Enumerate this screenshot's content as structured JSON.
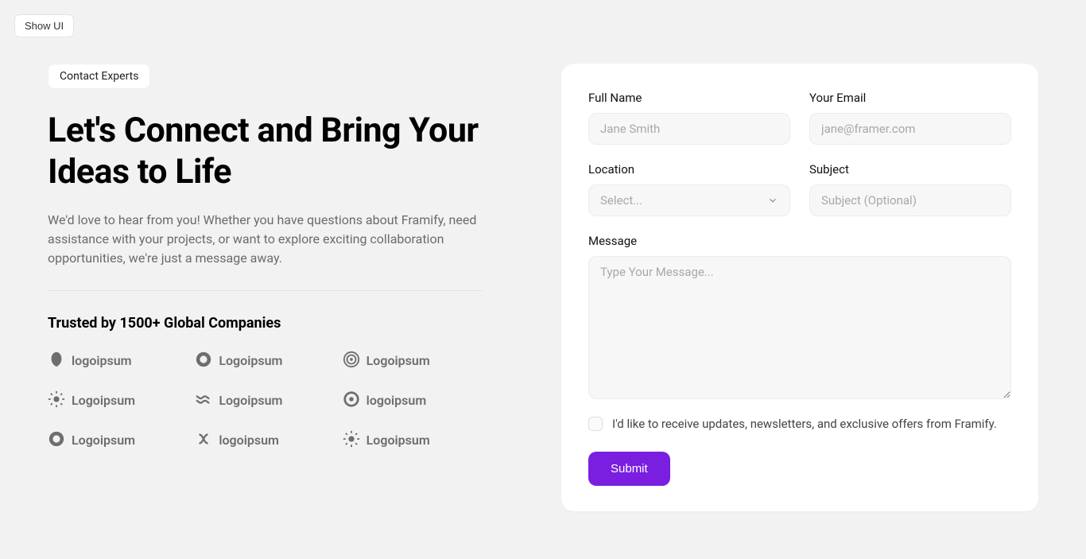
{
  "ui": {
    "show_ui_label": "Show UI"
  },
  "hero": {
    "badge": "Contact Experts",
    "heading": "Let's Connect and Bring Your Ideas to Life",
    "description": "We'd love to hear from you! Whether you have questions about Framify, need assistance with your projects, or want to explore exciting collaboration opportunities, we're just a message away.",
    "trusted_heading": "Trusted by 1500+ Global Companies"
  },
  "logos": [
    {
      "name": "logoipsum",
      "icon": "leaf"
    },
    {
      "name": "Logoipsum",
      "icon": "donut"
    },
    {
      "name": "Logoipsum",
      "icon": "rings"
    },
    {
      "name": "Logoipsum",
      "icon": "sun"
    },
    {
      "name": "Logoipsum",
      "icon": "waves"
    },
    {
      "name": "logoipsum",
      "icon": "target"
    },
    {
      "name": "Logoipsum",
      "icon": "donut"
    },
    {
      "name": "logoipsum",
      "icon": "knot"
    },
    {
      "name": "Logoipsum",
      "icon": "sun"
    }
  ],
  "form": {
    "full_name_label": "Full Name",
    "full_name_placeholder": "Jane Smith",
    "email_label": "Your Email",
    "email_placeholder": "jane@framer.com",
    "location_label": "Location",
    "location_placeholder": "Select...",
    "subject_label": "Subject",
    "subject_placeholder": "Subject (Optional)",
    "message_label": "Message",
    "message_placeholder": "Type Your Message...",
    "newsletter_label": "I'd like to receive updates, newsletters, and exclusive offers from Framify.",
    "submit_label": "Submit"
  },
  "colors": {
    "accent": "#7a1fe0"
  }
}
